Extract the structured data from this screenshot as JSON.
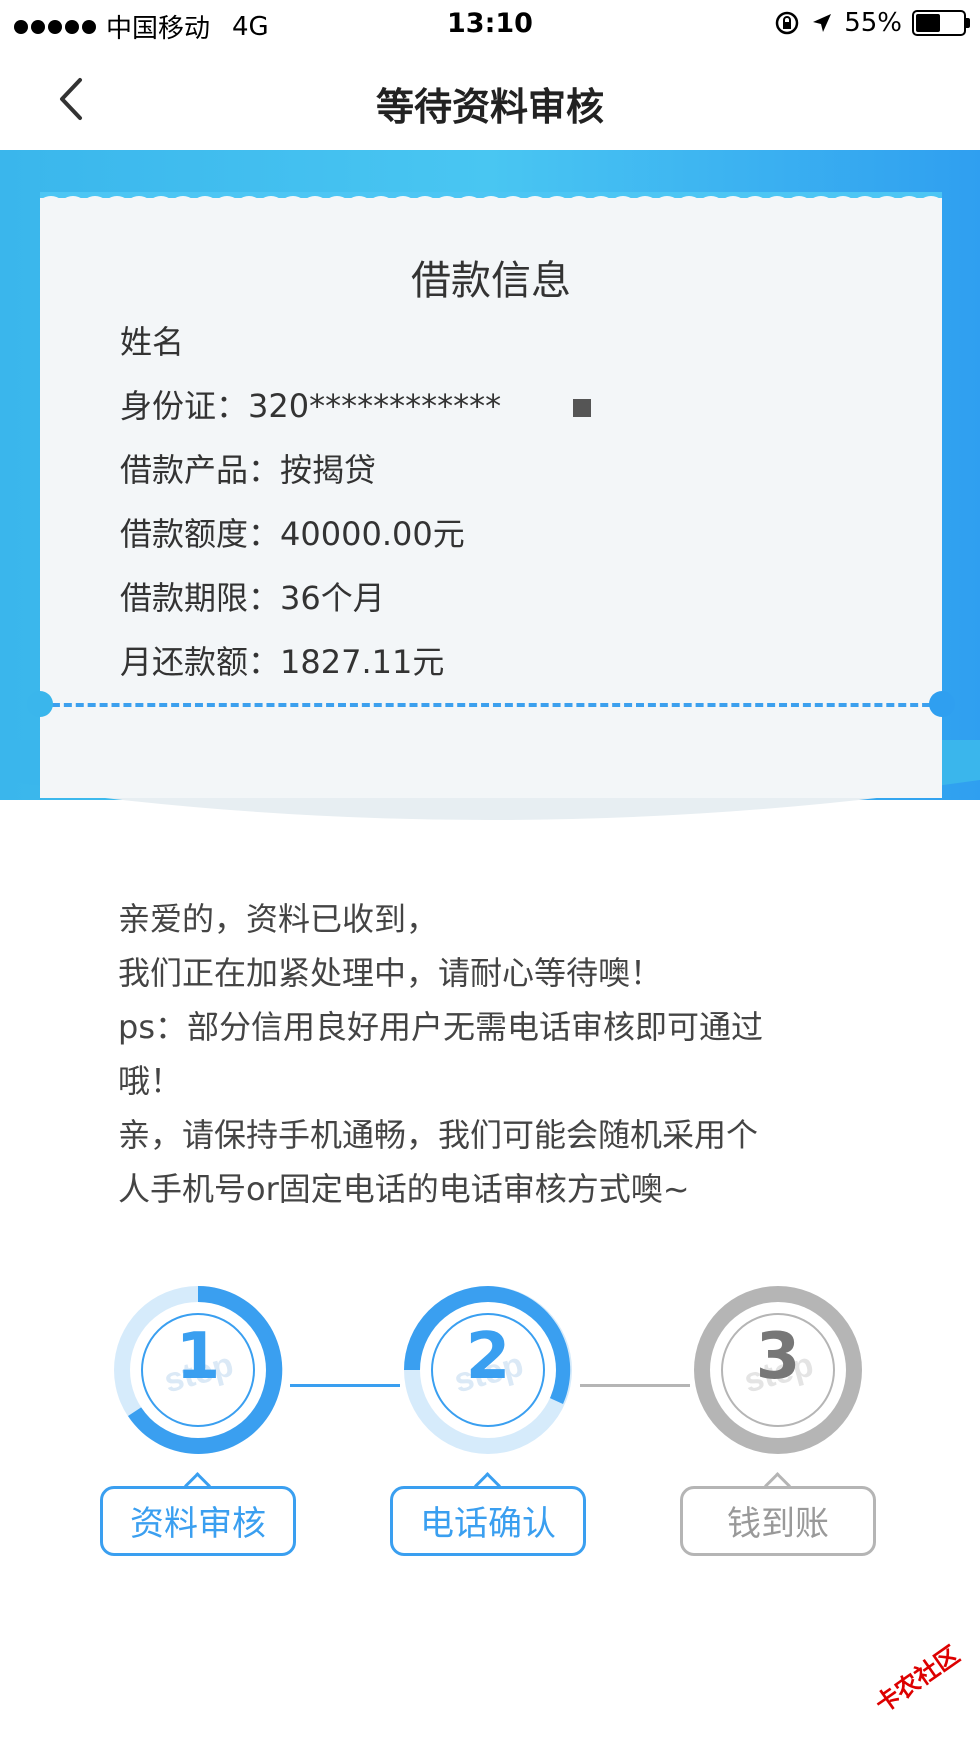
{
  "status_bar": {
    "carrier": "中国移动",
    "network": "4G",
    "time": "13:10",
    "battery": "55%",
    "battery_level": 0.55
  },
  "nav": {
    "title": "等待资料审核"
  },
  "loan_info": {
    "title": "借款信息",
    "rows": [
      {
        "label": "姓名",
        "value": ""
      },
      {
        "label": "身份证：",
        "value": "320************"
      },
      {
        "label": "借款产品：",
        "value": "按揭贷"
      },
      {
        "label": "借款额度：",
        "value": "40000.00元"
      },
      {
        "label": "借款期限：",
        "value": "36个月"
      },
      {
        "label": "月还款额：",
        "value": "1827.11元"
      }
    ]
  },
  "notice": {
    "lines": [
      "亲爱的，资料已收到，",
      "我们正在加紧处理中，请耐心等待噢！",
      "ps：部分信用良好用户无需电话审核即可通过",
      "哦！",
      "亲，请保持手机通畅，我们可能会随机采用个",
      "人手机号or固定电话的电话审核方式噢~"
    ]
  },
  "steps": [
    {
      "number": "1",
      "label": "资料审核",
      "state": "active",
      "color": "#3a9ff0"
    },
    {
      "number": "2",
      "label": "电话确认",
      "state": "active",
      "color": "#3a9ff0"
    },
    {
      "number": "3",
      "label": "钱到账",
      "state": "pending",
      "color": "#b5b5b5"
    }
  ],
  "watermark": "卡农社区",
  "colors": {
    "accent": "#3a9ff0",
    "header_blue": "#3ab6ec",
    "pending_gray": "#b5b5b5"
  }
}
